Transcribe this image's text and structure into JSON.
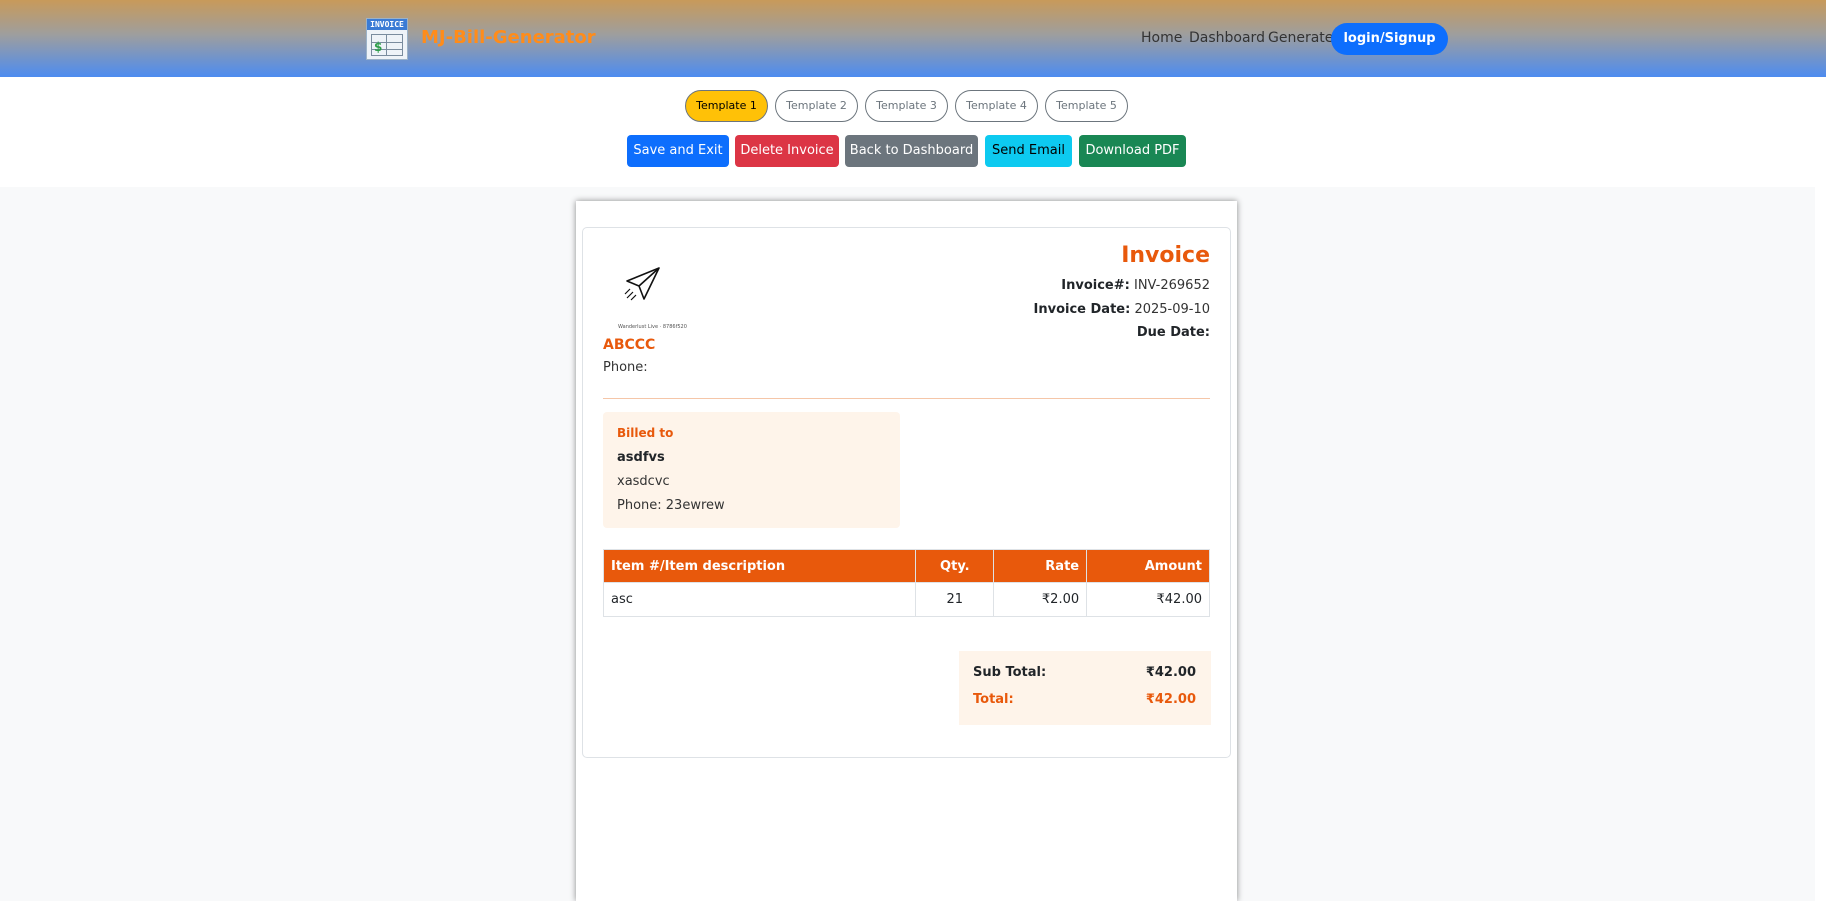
{
  "nav": {
    "brand": "MJ-Bill-Generator",
    "logo_text": "INVOICE",
    "links": [
      "Home",
      "Dashboard",
      "Generate"
    ],
    "login": "login/Signup"
  },
  "templates": [
    "Template 1",
    "Template 2",
    "Template 3",
    "Template 4",
    "Template 5"
  ],
  "active_template": "Template 1",
  "actions": {
    "save": "Save and Exit",
    "delete": "Delete Invoice",
    "back": "Back to Dashboard",
    "email": "Send Email",
    "pdf": "Download PDF"
  },
  "invoice": {
    "logo_caption": "Wanderlust Live · 8786f520",
    "company": "ABCCC",
    "phone_label": "Phone:",
    "title": "Invoice",
    "number_label": "Invoice#:",
    "number": "INV-269652",
    "date_label": "Invoice Date:",
    "date": "2025-09-10",
    "due_label": "Due Date:",
    "due": "",
    "billed": {
      "heading": "Billed to",
      "name": "asdfvs",
      "address": "xasdcvc",
      "phone": "Phone: 23ewrew"
    },
    "table": {
      "headers": [
        "Item #/Item description",
        "Qty.",
        "Rate",
        "Amount"
      ],
      "rows": [
        [
          "asc",
          "21",
          "₹2.00",
          "₹42.00"
        ]
      ]
    },
    "subtotal_label": "Sub Total:",
    "subtotal": "₹42.00",
    "total_label": "Total:",
    "total": "₹42.00"
  },
  "colors": {
    "accent": "#e8590c",
    "primary": "#0d6efd",
    "danger": "#dc3545",
    "secondary": "#6c757d",
    "info": "#0dcaf0",
    "success": "#198754",
    "warning": "#ffc107"
  }
}
